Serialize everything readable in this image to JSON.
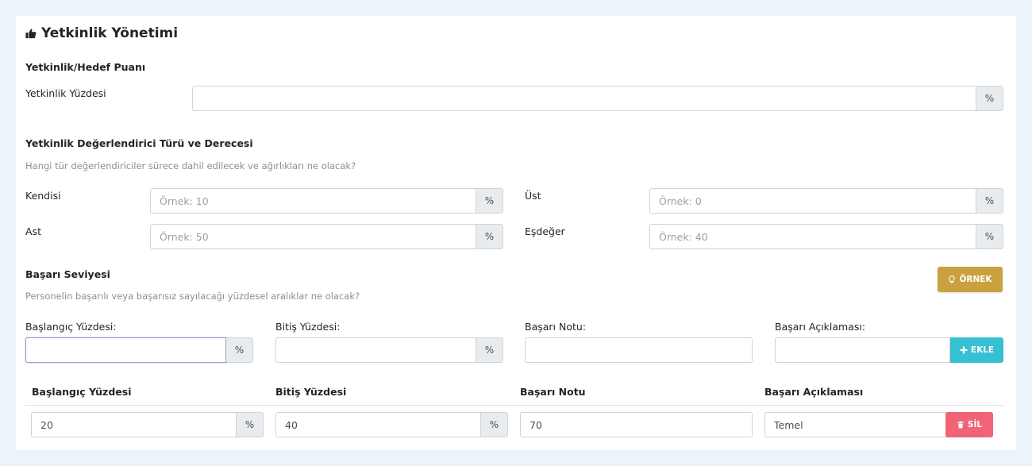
{
  "page": {
    "title": "Yetkinlik Yönetimi",
    "title_icon": "thumbs-up-icon"
  },
  "competency_score": {
    "section_title": "Yetkinlik/Hedef Puanı",
    "percentage_label": "Yetkinlik Yüzdesi",
    "percentage_value": "",
    "unit": "%"
  },
  "evaluators": {
    "section_title": "Yetkinlik Değerlendirici Türü ve Derecesi",
    "help_text": "Hangi tür değerlendiriciler sürece dahil edilecek ve ağırlıkları ne olacak?",
    "self_label": "Kendisi",
    "self_placeholder": "Örnek: 10",
    "upper_label": "Üst",
    "upper_placeholder": "Örnek: 0",
    "lower_label": "Ast",
    "lower_placeholder": "Örnek: 50",
    "peer_label": "Eşdeğer",
    "peer_placeholder": "Örnek: 40",
    "unit": "%"
  },
  "success_level": {
    "section_title": "Başarı Seviyesi",
    "help_text": "Personelin başarılı veya başarısız sayılacağı yüzdesel aralıklar ne olacak?",
    "example_button": "ÖRNEK",
    "start_label": "Başlangıç Yüzdesi:",
    "end_label": "Bitiş Yüzdesi:",
    "grade_label": "Başarı Notu:",
    "desc_label": "Başarı Açıklaması:",
    "add_button": "EKLE",
    "unit": "%"
  },
  "table": {
    "headers": [
      "Başlangıç Yüzdesi",
      "Bitiş Yüzdesi",
      "Başarı Notu",
      "Başarı Açıklaması"
    ],
    "rows": [
      {
        "start": "20",
        "end": "40",
        "grade": "70",
        "description": "Temel"
      }
    ],
    "delete_button": "SİL",
    "unit": "%"
  }
}
